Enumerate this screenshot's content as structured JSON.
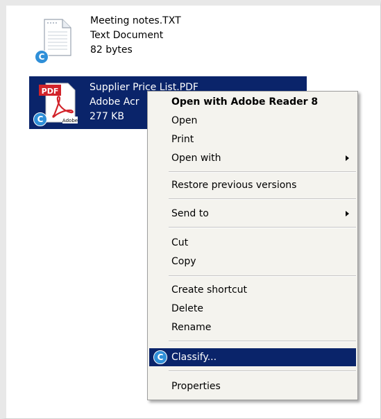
{
  "files": [
    {
      "name": "Meeting notes.TXT",
      "type": "Text Document",
      "size": "82 bytes",
      "icon": "text-document-icon"
    },
    {
      "name": "Supplier Price List.PDF",
      "type": "Adobe Acr",
      "size": "277 KB",
      "icon": "pdf-document-icon",
      "icon_label": "PDF",
      "icon_brand": "Adobe"
    }
  ],
  "badge_letter": "C",
  "context_menu": {
    "items": [
      {
        "label": "Open with Adobe Reader 8",
        "bold": true
      },
      {
        "label": "Open"
      },
      {
        "label": "Print"
      },
      {
        "label": "Open with",
        "submenu": true
      },
      {
        "label": "Restore previous versions"
      },
      {
        "label": "Send to",
        "submenu": true
      },
      {
        "label": "Cut"
      },
      {
        "label": "Copy"
      },
      {
        "label": "Create shortcut"
      },
      {
        "label": "Delete"
      },
      {
        "label": "Rename"
      },
      {
        "label": "Classify...",
        "highlighted": true
      },
      {
        "label": "Properties"
      }
    ]
  },
  "colors": {
    "selection": "#0a246a",
    "menu_background": "#f4f3ee",
    "badge": "#2f8fd8",
    "pdf_red": "#d2232a"
  }
}
